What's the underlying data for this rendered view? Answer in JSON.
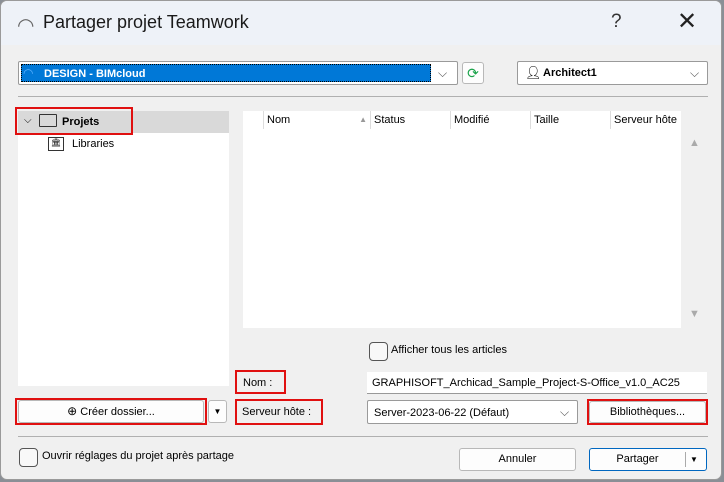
{
  "window": {
    "title": "Partager projet Teamwork",
    "help": "?",
    "close": "✕"
  },
  "server": {
    "selected": "DESIGN - BIMcloud"
  },
  "user": {
    "selected": "Architect1"
  },
  "tree": {
    "items": [
      {
        "label": "Projets"
      },
      {
        "label": "Libraries"
      }
    ]
  },
  "table": {
    "columns": [
      "Nom",
      "Status",
      "Modifié",
      "Taille",
      "Serveur hôte"
    ]
  },
  "show_all": {
    "label": "Afficher tous les articles"
  },
  "create_folder": {
    "label": "Créer dossier..."
  },
  "name": {
    "label": "Nom :",
    "value": "GRAPHISOFT_Archicad_Sample_Project-S-Office_v1.0_AC25"
  },
  "host": {
    "label": "Serveur hôte :",
    "value": "Server-2023-06-22 (Défaut)"
  },
  "libraries": {
    "label": "Bibliothèques..."
  },
  "open_settings": {
    "label": "Ouvrir réglages du projet après partage"
  },
  "cancel": {
    "label": "Annuler"
  },
  "share": {
    "label": "Partager"
  }
}
